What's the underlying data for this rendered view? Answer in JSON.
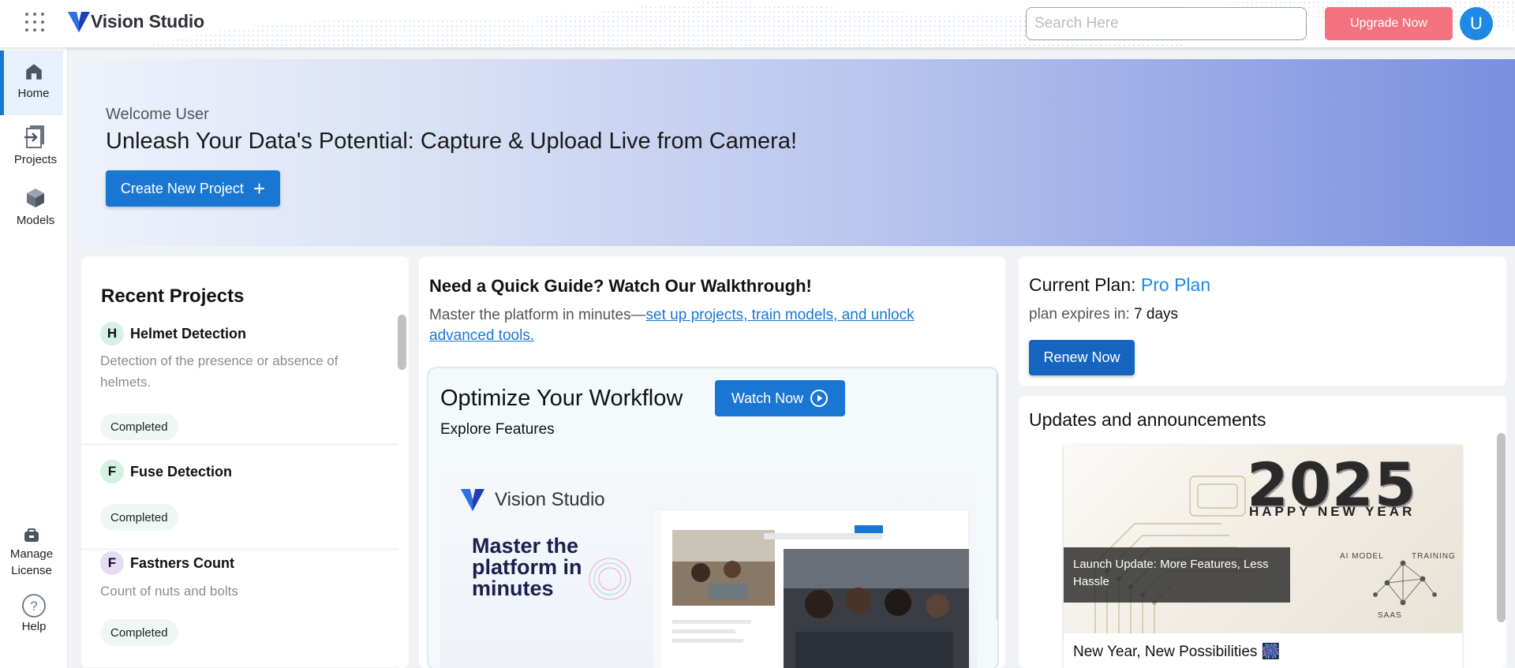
{
  "header": {
    "app_name": "Vision Studio",
    "search_placeholder": "Search Here",
    "upgrade_label": "Upgrade Now",
    "avatar_initial": "U"
  },
  "sidebar": {
    "items": [
      {
        "label": "Home",
        "icon": "home-icon",
        "active": true
      },
      {
        "label": "Projects",
        "icon": "projects-icon"
      },
      {
        "label": "Models",
        "icon": "cube-icon"
      }
    ],
    "manage_license": "Manage License",
    "help": "Help"
  },
  "hero": {
    "welcome": "Welcome User",
    "title": "Unleash Your Data's Potential: Capture & Upload Live from Camera!",
    "create_label": "Create New Project"
  },
  "recent": {
    "title": "Recent Projects",
    "projects": [
      {
        "letter": "H",
        "name": "Helmet Detection",
        "description": "Detection of the presence or absence of helmets.",
        "status": "Completed",
        "color": "#d4f1e4"
      },
      {
        "letter": "F",
        "name": "Fuse Detection",
        "description": "",
        "status": "Completed",
        "color": "#d4f1e4"
      },
      {
        "letter": "F",
        "name": "Fastners Count",
        "description": "Count of nuts and bolts",
        "status": "Completed",
        "color": "#e7dcf6"
      }
    ]
  },
  "guide": {
    "title": "Need a Quick Guide? Watch Our Walkthrough!",
    "subtitle_prefix": "Master the platform in minutes—",
    "subtitle_link": "set up projects, train models, and unlock advanced tools.",
    "inner_title": "Optimize Your Workflow",
    "watch_label": "Watch Now",
    "inner_subtitle": "Explore Features",
    "preview_brand": "Vision Studio",
    "preview_heading": "Master the platform in minutes"
  },
  "plan": {
    "label": "Current Plan:",
    "name": "Pro Plan",
    "expires_label": "plan expires in:",
    "expires_value": "7 days",
    "renew_label": "Renew Now"
  },
  "updates": {
    "title": "Updates and announcements",
    "image_year": "2025",
    "image_greeting": "HAPPY NEW YEAR",
    "image_tag_ai": "AI MODEL",
    "image_tag_training": "TRAINING",
    "image_tag_saas": "SAAS",
    "caption": "Launch Update: More Features, Less Hassle",
    "card_title": "New Year, New Possibilities 🎆"
  },
  "colors": {
    "primary": "#1976d2",
    "upgrade": "#f3727f",
    "pro_plan": "#1e88e5"
  }
}
